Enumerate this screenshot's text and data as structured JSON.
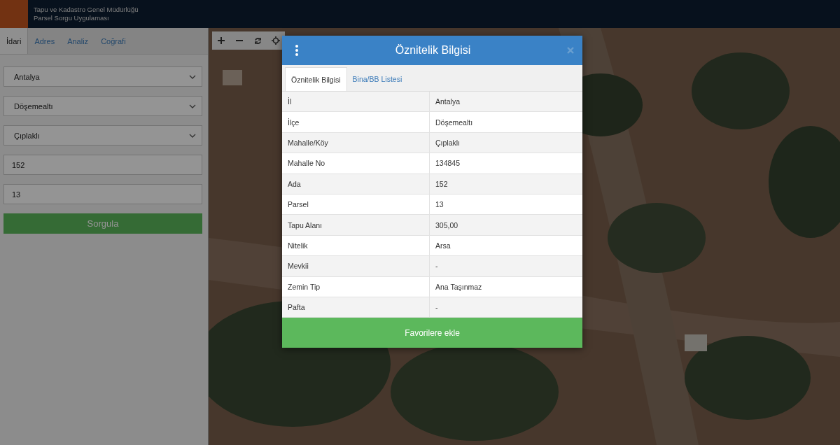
{
  "header": {
    "title": "Tapu ve Kadastro Genel Müdürlüğü",
    "subtitle": "Parsel Sorgu Uygulaması"
  },
  "sidebar": {
    "tabs": [
      {
        "label": "İdari",
        "selected": true
      },
      {
        "label": "Adres",
        "selected": false
      },
      {
        "label": "Analiz",
        "selected": false
      },
      {
        "label": "Coğrafi",
        "selected": false
      }
    ],
    "selects": [
      {
        "value": "Antalya"
      },
      {
        "value": "Döşemealtı"
      },
      {
        "value": "Çıplaklı"
      }
    ],
    "inputs": [
      {
        "value": "152"
      },
      {
        "value": "13"
      }
    ],
    "button": "Sorgula"
  },
  "dialog": {
    "title": "Öznitelik Bilgisi",
    "tabs": [
      {
        "label": "Öznitelik Bilgisi",
        "selected": true
      },
      {
        "label": "Bina/BB Listesi",
        "selected": false
      }
    ],
    "rows": [
      {
        "label": "İl",
        "value": "Antalya"
      },
      {
        "label": "İlçe",
        "value": "Döşemealtı"
      },
      {
        "label": "Mahalle/Köy",
        "value": "Çıplaklı"
      },
      {
        "label": "Mahalle No",
        "value": "134845"
      },
      {
        "label": "Ada",
        "value": "152"
      },
      {
        "label": "Parsel",
        "value": "13"
      },
      {
        "label": "Tapu Alanı",
        "value": "305,00"
      },
      {
        "label": "Nitelik",
        "value": "Arsa"
      },
      {
        "label": "Mevkii",
        "value": "-"
      },
      {
        "label": "Zemin Tip",
        "value": "Ana Taşınmaz"
      },
      {
        "label": "Pafta",
        "value": "-"
      }
    ],
    "button": "Favorilere ekle"
  }
}
